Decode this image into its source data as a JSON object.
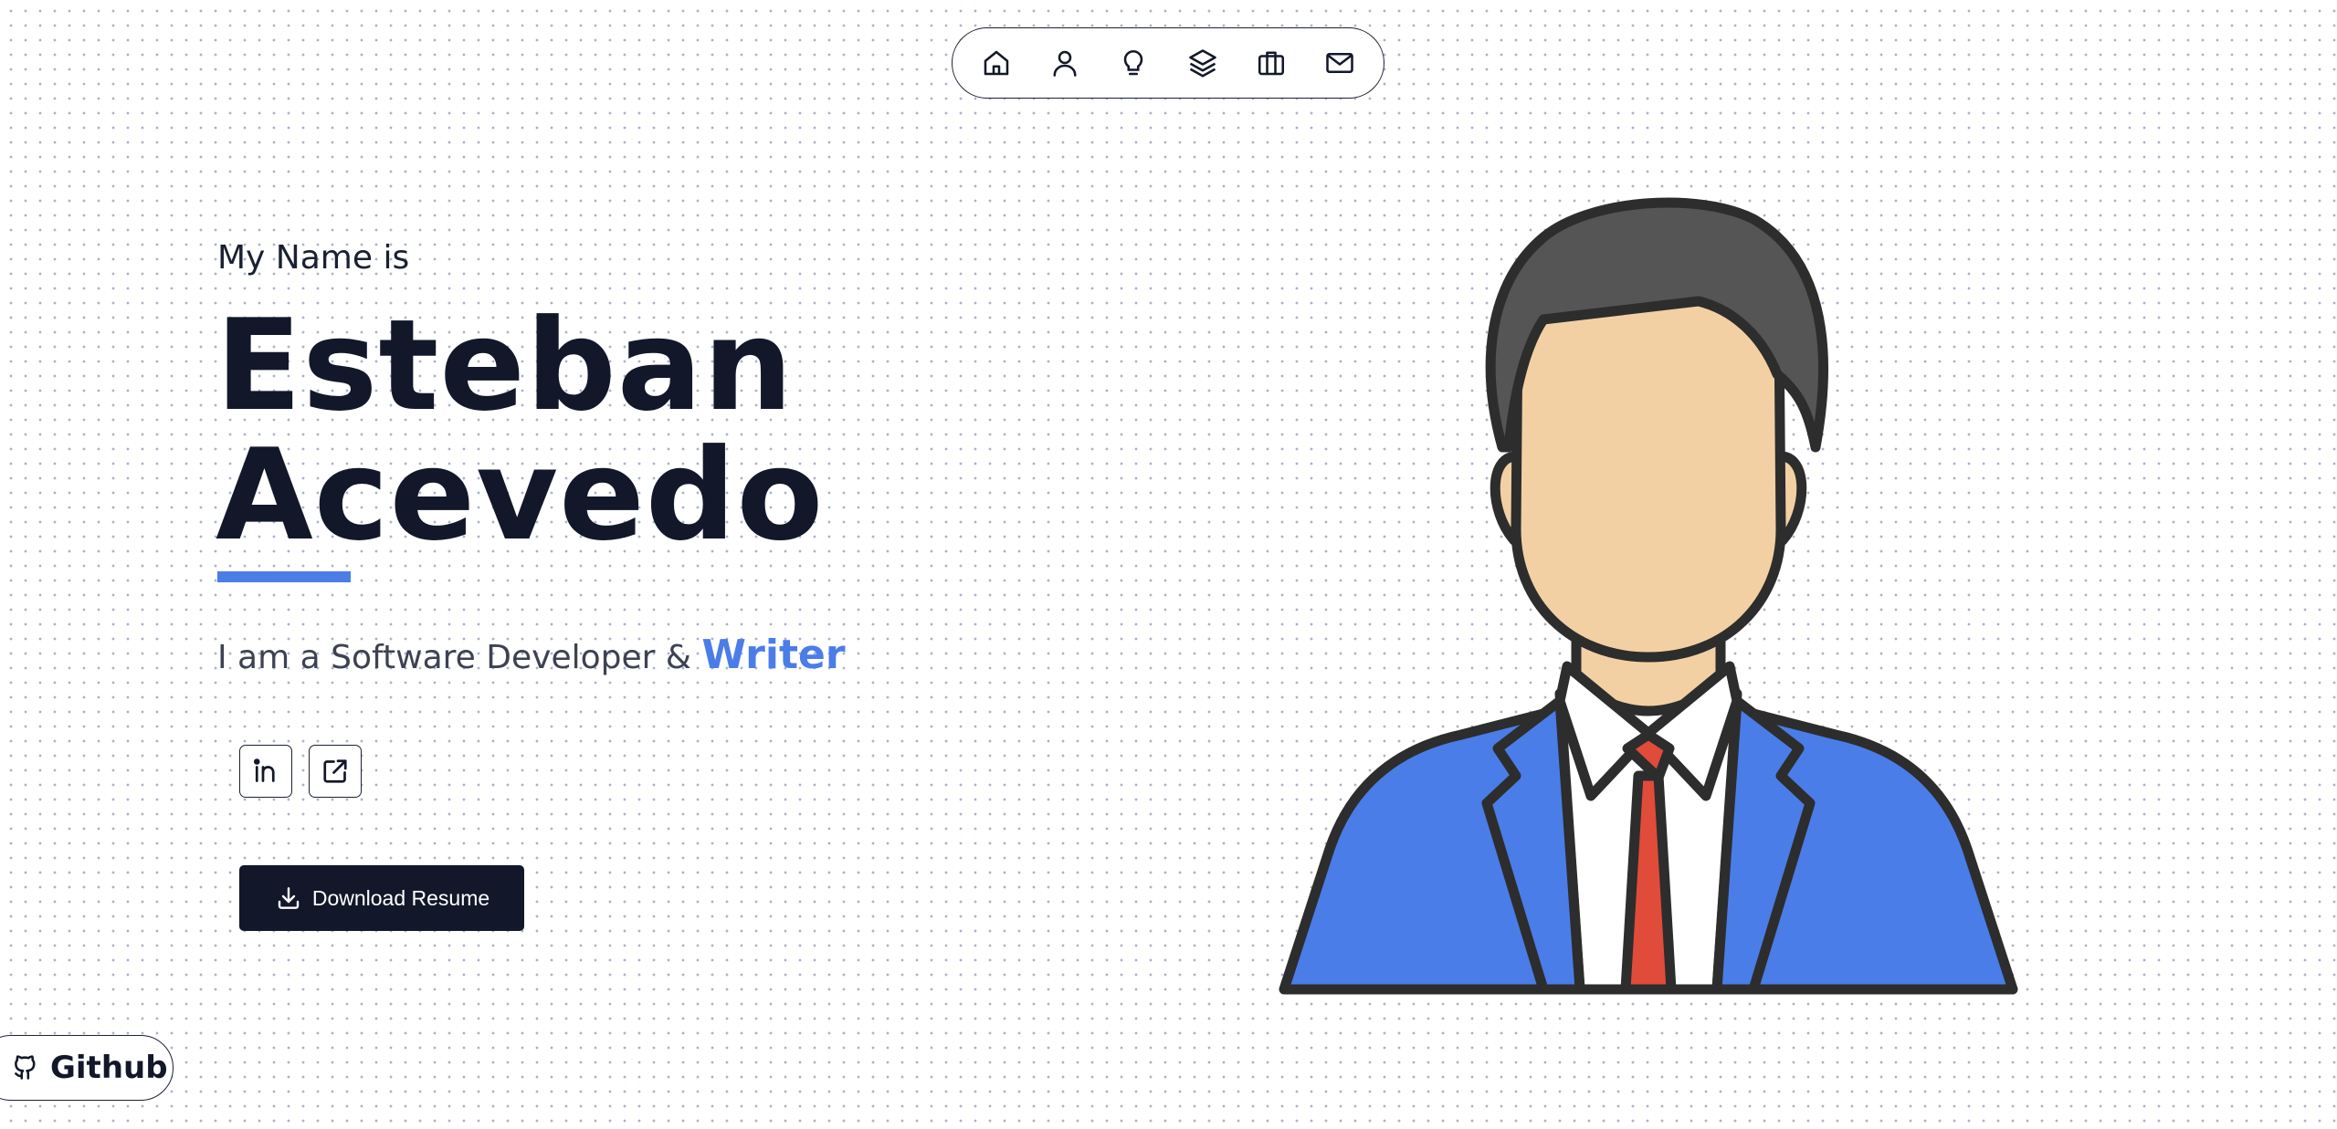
{
  "nav": {
    "items": [
      {
        "icon": "home-icon"
      },
      {
        "icon": "user-icon"
      },
      {
        "icon": "lightbulb-icon"
      },
      {
        "icon": "layers-icon"
      },
      {
        "icon": "briefcase-icon"
      },
      {
        "icon": "mail-icon"
      }
    ]
  },
  "hero": {
    "intro": "My Name is",
    "first_name": "Esteban",
    "last_name": "Acevedo",
    "role_prefix": "I am a Software Developer &",
    "role_accent": "Writer"
  },
  "social": [
    {
      "icon": "linkedin-icon"
    },
    {
      "icon": "external-link-icon"
    }
  ],
  "download": {
    "label": "Download Resume",
    "icon": "download-icon"
  },
  "github": {
    "label": "Github",
    "icon": "github-icon"
  },
  "colors": {
    "accent": "#4a7de8",
    "dark": "#121829",
    "suit": "#4a7de8",
    "tie": "#e04b3a",
    "skin": "#f3d0a3",
    "hair": "#555555"
  }
}
